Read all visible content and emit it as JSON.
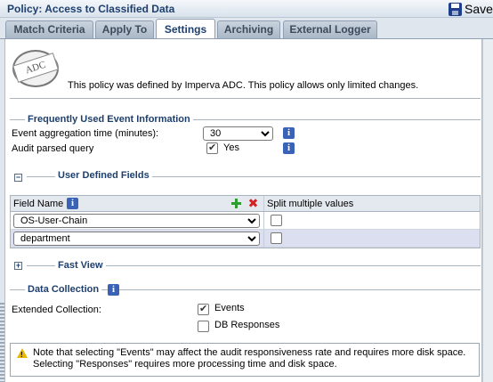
{
  "window": {
    "title": "Policy: Access to Classified Data",
    "save_label": "Save"
  },
  "tabs": [
    {
      "label": "Match Criteria",
      "active": false
    },
    {
      "label": "Apply To",
      "active": false
    },
    {
      "label": "Settings",
      "active": true
    },
    {
      "label": "Archiving",
      "active": false
    },
    {
      "label": "External Logger",
      "active": false
    }
  ],
  "stamp": {
    "text": "ADC"
  },
  "intro_text": "This policy was defined by Imperva ADC. This policy allows only limited changes.",
  "event_info": {
    "section_title": "Frequently Used Event Information",
    "aggregation_label": "Event aggregation time (minutes):",
    "aggregation_value": "30",
    "audit_label": "Audit parsed query",
    "audit_checked": true,
    "audit_value_label": "Yes"
  },
  "user_fields": {
    "section_title": "User Defined Fields",
    "toggle": "−",
    "columns": {
      "field_name": "Field Name",
      "split": "Split multiple values"
    },
    "rows": [
      {
        "field": "OS-User-Chain",
        "split": false
      },
      {
        "field": "department",
        "split": false
      }
    ]
  },
  "fast_view": {
    "section_title": "Fast View",
    "toggle": "+"
  },
  "data_collection": {
    "section_title": "Data Collection",
    "extended_label": "Extended Collection:",
    "options": [
      {
        "label": "Events",
        "checked": true
      },
      {
        "label": "DB Responses",
        "checked": false
      }
    ]
  },
  "note": {
    "line1": "Note that selecting \"Events\" may affect the audit responsiveness rate and requires more disk space.",
    "line2": "Selecting \"Responses\" requires more processing time and disk space."
  },
  "icons": {
    "info": "info-icon",
    "save": "floppy-disk-icon",
    "add": "add-icon",
    "delete": "delete-icon",
    "warning": "warning-icon"
  },
  "colors": {
    "accent": "#1d3f6e",
    "info_icon": "#3a63b8",
    "selected_row": "#dcdff0"
  }
}
